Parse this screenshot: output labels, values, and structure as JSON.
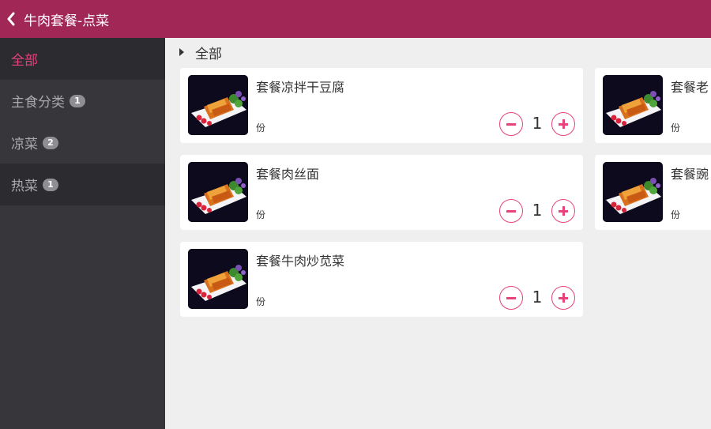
{
  "header": {
    "title": "牛肉套餐-点菜",
    "back_icon": "chevron-left-icon"
  },
  "colors": {
    "header": "#a02756",
    "accent": "#e8427c",
    "sidebar": "#37363b",
    "sidebar_active": "#2c2b30"
  },
  "sidebar": {
    "items": [
      {
        "label": "全部",
        "badge": ""
      },
      {
        "label": "主食分类",
        "badge": "1"
      },
      {
        "label": "凉菜",
        "badge": "2"
      },
      {
        "label": "热菜",
        "badge": "1"
      }
    ]
  },
  "section": {
    "title": "全部"
  },
  "dishes": [
    {
      "name": "套餐凉拌干豆腐",
      "unit": "份",
      "qty": "1"
    },
    {
      "name": "套餐老",
      "unit": "份",
      "qty": ""
    },
    {
      "name": "套餐肉丝面",
      "unit": "份",
      "qty": "1"
    },
    {
      "name": "套餐豌",
      "unit": "份",
      "qty": ""
    },
    {
      "name": "套餐牛肉炒苋菜",
      "unit": "份",
      "qty": "1"
    }
  ]
}
